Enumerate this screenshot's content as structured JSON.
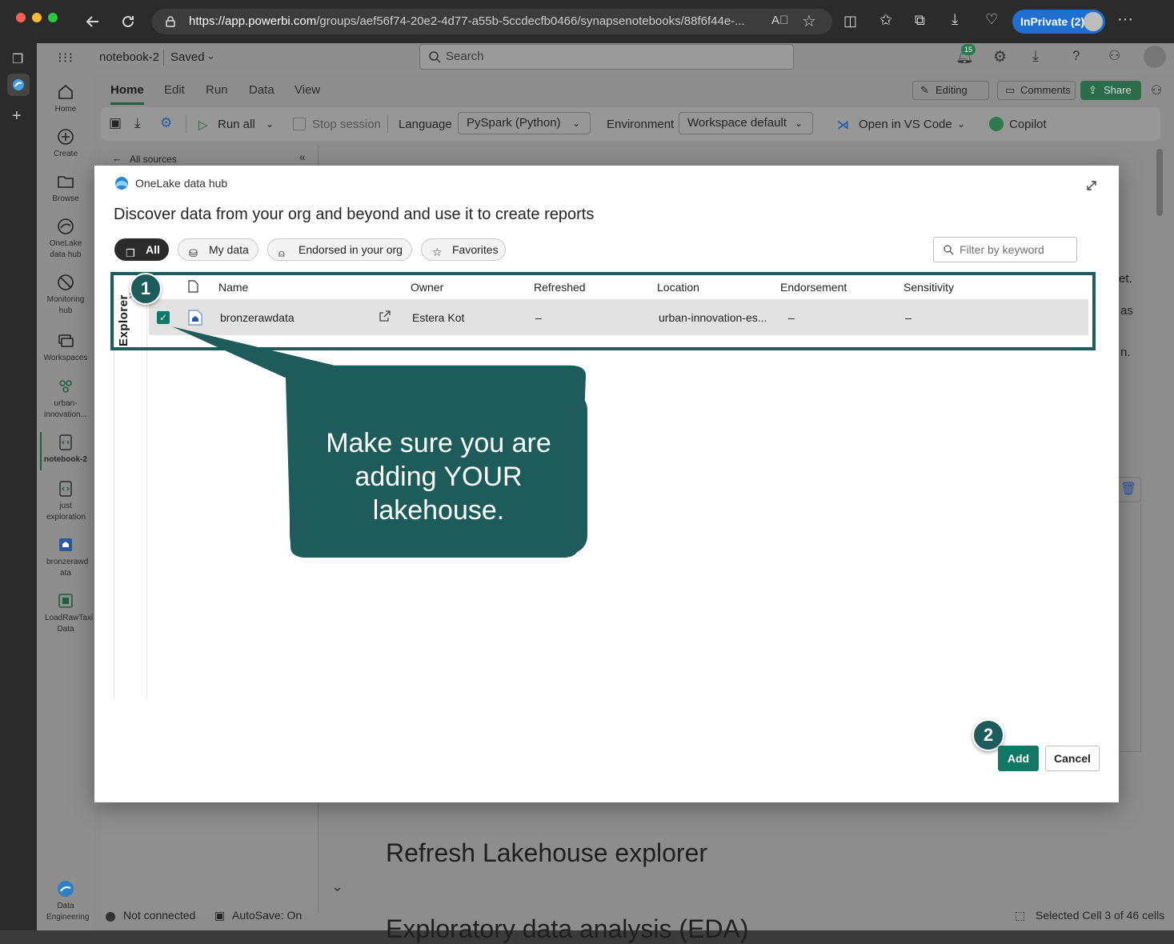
{
  "browser": {
    "url_host": "https://app.powerbi.com",
    "url_path": "/groups/aef56f74-20e2-4d77-a55b-5ccdecfb0466/synapsenotebooks/88f6f44e-...",
    "inprivate": "InPrivate (2)"
  },
  "topbar": {
    "notebook_name": "notebook-2",
    "saved": "Saved",
    "search_placeholder": "Search",
    "notification_count": "15"
  },
  "rail": {
    "items": [
      {
        "label": "Home",
        "icon": "home-icon"
      },
      {
        "label": "Create",
        "icon": "plus-circle-icon"
      },
      {
        "label": "Browse",
        "icon": "folder-icon"
      },
      {
        "label": "OneLake data hub",
        "icon": "onelake-icon"
      },
      {
        "label": "Monitoring hub",
        "icon": "monitor-icon"
      },
      {
        "label": "Workspaces",
        "icon": "workspaces-icon"
      },
      {
        "label": "urban-innovation...",
        "icon": "workspace-group-icon"
      },
      {
        "label": "notebook-2",
        "icon": "notebook-icon"
      },
      {
        "label": "just exploration",
        "icon": "notebook-icon"
      },
      {
        "label": "bronzerawd ata",
        "icon": "lakehouse-icon"
      },
      {
        "label": "LoadRawTaxi Data",
        "icon": "pipeline-icon"
      }
    ],
    "bottom_label": "Data Engineering"
  },
  "ribbon": {
    "tabs": [
      "Home",
      "Edit",
      "Run",
      "Data",
      "View"
    ],
    "editing": "Editing",
    "comments": "Comments",
    "share": "Share",
    "run_all": "Run all",
    "stop_session": "Stop session",
    "language_label": "Language",
    "language_value": "PySpark (Python)",
    "environment_label": "Environment",
    "environment_value": "Workspace default",
    "open_vscode": "Open in VS Code",
    "copilot": "Copilot"
  },
  "background": {
    "all_sources": "All sources",
    "partial_right_1": "et.",
    "partial_right_2": "as",
    "partial_right_3": "n.",
    "heading_1": "Refresh Lakehouse explorer",
    "heading_2": "Exploratory data analysis (EDA)",
    "status_connection": "Not connected",
    "status_autosave": "AutoSave: On",
    "status_selection": "Selected Cell 3 of 46 cells"
  },
  "modal": {
    "header": "OneLake data hub",
    "title": "Discover data from your org and beyond and use it to create reports",
    "filters": [
      "All",
      "My data",
      "Endorsed in your org",
      "Favorites"
    ],
    "filter_placeholder": "Filter by keyword",
    "explorer_label": "Explorer",
    "columns": [
      "Name",
      "Owner",
      "Refreshed",
      "Location",
      "Endorsement",
      "Sensitivity"
    ],
    "rows": [
      {
        "name": "bronzerawdata",
        "owner": "Estera Kot",
        "refreshed": "–",
        "location": "urban-innovation-es...",
        "endorsement": "–",
        "sensitivity": "–"
      }
    ],
    "add": "Add",
    "cancel": "Cancel"
  },
  "annotations": {
    "badge_1": "1",
    "badge_2": "2",
    "callout": "Make sure you are adding YOUR lakehouse.",
    "accent": "#1d5c5a"
  }
}
